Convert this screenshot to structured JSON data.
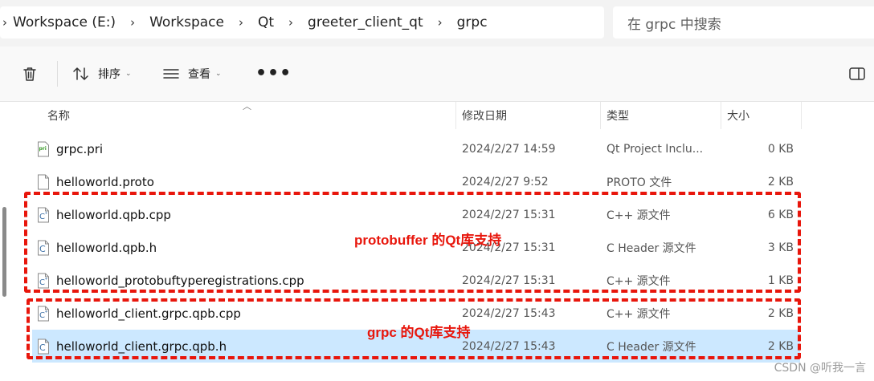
{
  "address": {
    "crumbs": [
      "Workspace (E:)",
      "Workspace",
      "Qt",
      "greeter_client_qt",
      "grpc"
    ],
    "search_placeholder": "在 grpc 中搜索"
  },
  "toolbar": {
    "sort_label": "排序",
    "view_label": "查看",
    "more_label": "•••"
  },
  "columns": {
    "name": "名称",
    "date": "修改日期",
    "type": "类型",
    "size": "大小"
  },
  "files": [
    {
      "name": "grpc.pri",
      "date": "2024/2/27 14:59",
      "type": "Qt Project Inclu...",
      "size": "0 KB",
      "icon": "pri-file-icon"
    },
    {
      "name": "helloworld.proto",
      "date": "2024/2/27 9:52",
      "type": "PROTO 文件",
      "size": "2 KB",
      "icon": "blank-file-icon"
    },
    {
      "name": "helloworld.qpb.cpp",
      "date": "2024/2/27 15:31",
      "type": "C++ 源文件",
      "size": "6 KB",
      "icon": "cpp-file-icon"
    },
    {
      "name": "helloworld.qpb.h",
      "date": "2024/2/27 15:31",
      "type": "C Header 源文件",
      "size": "3 KB",
      "icon": "header-file-icon"
    },
    {
      "name": "helloworld_protobuftyperegistrations.cpp",
      "date": "2024/2/27 15:31",
      "type": "C++ 源文件",
      "size": "1 KB",
      "icon": "cpp-file-icon"
    },
    {
      "name": "helloworld_client.grpc.qpb.cpp",
      "date": "2024/2/27 15:43",
      "type": "C++ 源文件",
      "size": "2 KB",
      "icon": "cpp-file-icon"
    },
    {
      "name": "helloworld_client.grpc.qpb.h",
      "date": "2024/2/27 15:43",
      "type": "C Header 源文件",
      "size": "2 KB",
      "icon": "header-file-icon"
    }
  ],
  "annotations": {
    "protobuf": "protobuffer 的Qt库支持",
    "grpc": "grpc 的Qt库支持"
  },
  "watermark": "CSDN @听我一言",
  "colors": {
    "annotation": "#e8160c",
    "selection": "#cce8ff"
  }
}
